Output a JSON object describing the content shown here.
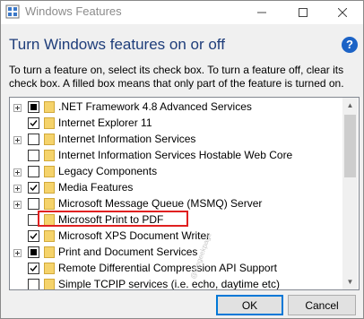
{
  "window": {
    "title": "Windows Features"
  },
  "header": {
    "heading": "Turn Windows features on or off",
    "description": "To turn a feature on, select its check box. To turn a feature off, clear its check box. A filled box means that only part of the feature is turned on."
  },
  "features": [
    {
      "label": ".NET Framework 4.8 Advanced Services",
      "state": "partial",
      "expandable": true
    },
    {
      "label": "Internet Explorer 11",
      "state": "checked",
      "expandable": false
    },
    {
      "label": "Internet Information Services",
      "state": "unchecked",
      "expandable": true
    },
    {
      "label": "Internet Information Services Hostable Web Core",
      "state": "unchecked",
      "expandable": false
    },
    {
      "label": "Legacy Components",
      "state": "unchecked",
      "expandable": true
    },
    {
      "label": "Media Features",
      "state": "checked",
      "expandable": true
    },
    {
      "label": "Microsoft Message Queue (MSMQ) Server",
      "state": "unchecked",
      "expandable": true
    },
    {
      "label": "Microsoft Print to PDF",
      "state": "unchecked",
      "expandable": false
    },
    {
      "label": "Microsoft XPS Document Writer",
      "state": "checked",
      "expandable": false
    },
    {
      "label": "Print and Document Services",
      "state": "partial",
      "expandable": true
    },
    {
      "label": "Remote Differential Compression API Support",
      "state": "checked",
      "expandable": false
    },
    {
      "label": "Simple TCPIP services (i.e. echo, daytime etc)",
      "state": "unchecked",
      "expandable": false
    }
  ],
  "buttons": {
    "ok": "OK",
    "cancel": "Cancel"
  },
  "watermark": "@thegeekpage",
  "colors": {
    "heading": "#1e3d7a",
    "highlight": "#e02020",
    "folder": "#f5d36b",
    "help": "#1c63c6",
    "ok_border": "#0078d7"
  }
}
